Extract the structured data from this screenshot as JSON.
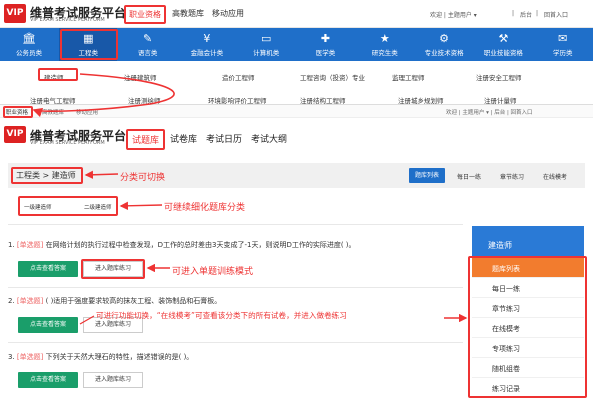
{
  "header": {
    "logo_text": "VIP",
    "brand": "维普考试服务平台",
    "brand_sub": "VIP EXAM SERVICE PLATFORM",
    "nav": [
      "职业资格",
      "高教题库",
      "移动应用"
    ],
    "top_right": [
      "欢迎 | 主题用户 ▾",
      "|",
      "后台",
      "|",
      "回首入口"
    ]
  },
  "categories": [
    {
      "label": "公务员类",
      "icon": "building-icon",
      "glyph": "🏛"
    },
    {
      "label": "工程类",
      "icon": "grid-icon",
      "glyph": "▦"
    },
    {
      "label": "语言类",
      "icon": "book-icon",
      "glyph": "✎"
    },
    {
      "label": "金融会计类",
      "icon": "money-icon",
      "glyph": "¥"
    },
    {
      "label": "计算机类",
      "icon": "computer-icon",
      "glyph": "▭"
    },
    {
      "label": "医学类",
      "icon": "medical-icon",
      "glyph": "✚"
    },
    {
      "label": "研究生类",
      "icon": "graduate-icon",
      "glyph": "★"
    },
    {
      "label": "专业技术资格",
      "icon": "tech-icon",
      "glyph": "⚙"
    },
    {
      "label": "职业技能资格",
      "icon": "skill-icon",
      "glyph": "⚒"
    },
    {
      "label": "学历类",
      "icon": "diploma-icon",
      "glyph": "✉"
    }
  ],
  "sub_links_row1": [
    "建造师",
    "注册建筑师",
    "造价工程师",
    "工程咨询（投资）专业",
    "监理工程师",
    "注册安全工程师"
  ],
  "sub_links_row2": [
    "注册电气工程师",
    "注册测绘师",
    "环境影响评价工程师",
    "注册结构工程师",
    "注册城乡规划师",
    "注册计量师"
  ],
  "header2": {
    "nav": [
      "职业资格",
      "高教题库",
      "移动应用"
    ],
    "top_right": "欢迎 | 主题用户 ▾  |  后台  |  回首入口"
  },
  "tabs": [
    "试题库",
    "试卷库",
    "考试日历",
    "考试大纲"
  ],
  "breadcrumb": "工程类 > 建造师",
  "mode_buttons": [
    "题库列表",
    "每日一练",
    "章节练习",
    "在线模考"
  ],
  "sub_categories": [
    "一级建造师",
    "二级建造师"
  ],
  "annotations": {
    "switch_category": "分类可切换",
    "refine_category": "可继续细化题库分类",
    "single_training": "可进入单题训练模式",
    "function_switch": "可进行功能切换，“在线模考”可查看该分类下的所有试卷，并进入做卷练习"
  },
  "questions": [
    {
      "num": "1.",
      "tag": "[单选题]",
      "text": "在网络计划的执行过程中检查发现，D工作的总时差由3天变成了-1天，则说明D工作的实际进度( )。",
      "btn1": "点击查看答案",
      "btn2": "进入题库练习"
    },
    {
      "num": "2.",
      "tag": "[单选题]",
      "text": "( )适用于强度要求较高的抹灰工程、装饰制品和石膏板。",
      "btn1": "点击查看答案",
      "btn2": "进入题库练习"
    },
    {
      "num": "3.",
      "tag": "[单选题]",
      "text": "下列关于天然大理石的特性，描述错误的是( )。",
      "btn1": "点击查看答案",
      "btn2": "进入题库练习"
    }
  ],
  "right_panel": {
    "title": "建造师",
    "items": [
      "题库列表",
      "每日一练",
      "章节练习",
      "在线模考",
      "专项练习",
      "随机组卷",
      "练习记录"
    ]
  },
  "colors": {
    "accent": "#1f6fc9",
    "annotation": "#e33333",
    "green": "#1a9e6a",
    "orange": "#f27c2e"
  }
}
